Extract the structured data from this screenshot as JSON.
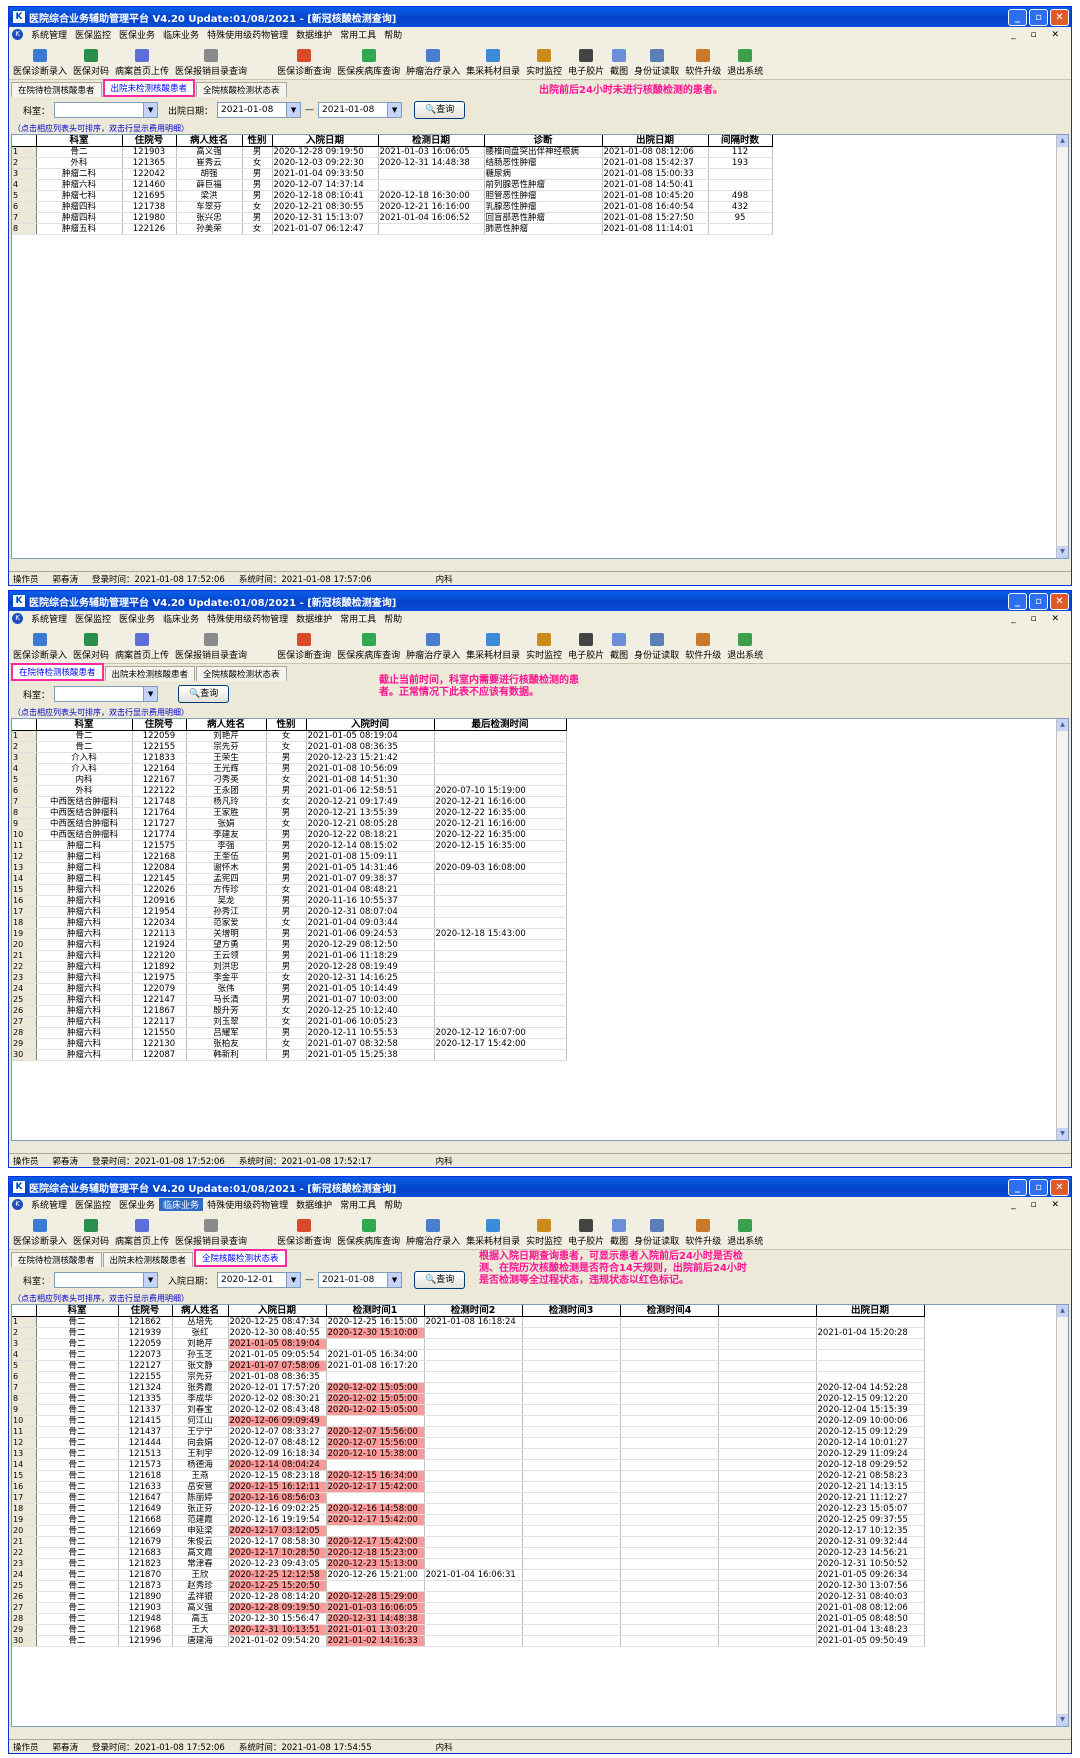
{
  "app": {
    "title": "医院综合业务辅助管理平台 V4.20 Update:01/08/2021 - [新冠核酸检测查询]",
    "menus": [
      "系统管理",
      "医保监控",
      "医保业务",
      "临床业务",
      "特殊使用级药物管理",
      "数据维护",
      "常用工具",
      "帮助"
    ],
    "toolbar_left": [
      "医保诊断录入",
      "医保对码",
      "病案首页上传",
      "医保报销目录查询"
    ],
    "toolbar_right": [
      "医保诊断查询",
      "医保疾病库查询",
      "肿瘤治疗录入",
      "集采耗材目录",
      "实时监控",
      "电子胶片",
      "截图",
      "身份证读取",
      "软件升级",
      "退出系统"
    ],
    "tabs": [
      "在院待检测核酸患者",
      "出院未检测核酸患者",
      "全院核酸检测状态表"
    ],
    "hint": "（点击相应列表头可排序，双击行显示费用明细）",
    "labels": {
      "dept": "科室：",
      "discharge_date": "出院日期：",
      "admit_date": "入院日期：",
      "query": "查询",
      "dash": "—"
    },
    "status": {
      "operator_label": "操作员",
      "operator": "郭春涛",
      "login_label": "登录时间：",
      "login_time": "2021-01-08 17:52:06",
      "sys_label": "系统时间：",
      "dept": "内科"
    }
  },
  "panel1": {
    "date_from": "2021-01-08",
    "date_to": "2021-01-08",
    "note": "出院前后24小时未进行核酸检测的患者。",
    "sys_time": "2021-01-08 17:57:06",
    "columns": [
      "",
      "科室",
      "住院号",
      "病人姓名",
      "性别",
      "入院日期",
      "检测日期",
      "诊断",
      "出院日期",
      "间隔时数"
    ],
    "rows": [
      [
        "1",
        "骨二",
        "121903",
        "高义强",
        "男",
        "2020-12-28 09:19:50",
        "2021-01-03 16:06:05",
        "腰椎间盘突出伴神经根病",
        "2021-01-08 08:12:06",
        "112"
      ],
      [
        "2",
        "外科",
        "121365",
        "崔秀云",
        "女",
        "2020-12-03 09:22:30",
        "2020-12-31 14:48:38",
        "结肠恶性肿瘤",
        "2021-01-08 15:42:37",
        "193"
      ],
      [
        "3",
        "肿瘤二科",
        "122042",
        "胡强",
        "男",
        "2021-01-04 09:33:50",
        "",
        "糖尿病",
        "2021-01-08 15:00:33",
        ""
      ],
      [
        "4",
        "肿瘤六科",
        "121460",
        "薛巨福",
        "男",
        "2020-12-07 14:37:14",
        "",
        "前列腺恶性肿瘤",
        "2021-01-08 14:50:41",
        ""
      ],
      [
        "5",
        "肿瘤七科",
        "121695",
        "梁洪",
        "男",
        "2020-12-18 08:10:41",
        "2020-12-18 16:30:00",
        "胆管恶性肿瘤",
        "2021-01-08 10:45:20",
        "498"
      ],
      [
        "6",
        "肿瘤四科",
        "121738",
        "车翠芬",
        "女",
        "2020-12-21 08:30:55",
        "2020-12-21 16:16:00",
        "乳腺恶性肿瘤",
        "2021-01-08 16:40:54",
        "432"
      ],
      [
        "7",
        "肿瘤四科",
        "121980",
        "张兴忠",
        "男",
        "2020-12-31 15:13:07",
        "2021-01-04 16:06:52",
        "回盲部恶性肿瘤",
        "2021-01-08 15:27:50",
        "95"
      ],
      [
        "8",
        "肿瘤五科",
        "122126",
        "孙美荣",
        "女",
        "2021-01-07 06:12:47",
        "",
        "肺恶性肿瘤",
        "2021-01-08 11:14:01",
        ""
      ]
    ]
  },
  "panel2": {
    "note": "截止当前时间，科室内需要进行核酸检测的患者。正常情况下此表不应该有数据。",
    "sys_time": "2021-01-08 17:52:17",
    "columns": [
      "",
      "科室",
      "住院号",
      "病人姓名",
      "性别",
      "入院时间",
      "最后检测时间"
    ],
    "rows": [
      [
        "1",
        "骨二",
        "122059",
        "刘艳芹",
        "女",
        "2021-01-05 08:19:04",
        ""
      ],
      [
        "2",
        "骨二",
        "122155",
        "宗先芬",
        "女",
        "2021-01-08 08:36:35",
        ""
      ],
      [
        "3",
        "介入科",
        "121833",
        "王荣生",
        "男",
        "2020-12-23 15:21:42",
        ""
      ],
      [
        "4",
        "介入科",
        "122164",
        "王光辉",
        "男",
        "2021-01-08 10:56:09",
        ""
      ],
      [
        "5",
        "内科",
        "122167",
        "刁秀英",
        "女",
        "2021-01-08 14:51:30",
        ""
      ],
      [
        "6",
        "外科",
        "122122",
        "王永团",
        "男",
        "2021-01-06 12:58:51",
        "2020-07-10 15:19:00"
      ],
      [
        "7",
        "中西医结合肿瘤科",
        "121748",
        "杨凡玲",
        "女",
        "2020-12-21 09:17:49",
        "2020-12-21 16:16:00"
      ],
      [
        "8",
        "中西医结合肿瘤科",
        "121764",
        "王家胜",
        "男",
        "2020-12-21 13:55:39",
        "2020-12-22 16:35:00"
      ],
      [
        "9",
        "中西医结合肿瘤科",
        "121727",
        "张娟",
        "女",
        "2020-12-21 08:05:28",
        "2020-12-21 16:16:00"
      ],
      [
        "10",
        "中西医结合肿瘤科",
        "121774",
        "李建友",
        "男",
        "2020-12-22 08:18:21",
        "2020-12-22 16:35:00"
      ],
      [
        "11",
        "肿瘤二科",
        "121575",
        "李强",
        "男",
        "2020-12-14 08:15:02",
        "2020-12-15 16:35:00"
      ],
      [
        "12",
        "肿瘤二科",
        "122168",
        "王奎伍",
        "男",
        "2021-01-08 15:09:11",
        ""
      ],
      [
        "13",
        "肿瘤二科",
        "122084",
        "谢怀木",
        "男",
        "2021-01-05 14:31:46",
        "2020-09-03 16:08:00"
      ],
      [
        "14",
        "肿瘤二科",
        "122145",
        "孟宪四",
        "男",
        "2021-01-07 09:38:37",
        ""
      ],
      [
        "15",
        "肿瘤六科",
        "122026",
        "方传珍",
        "女",
        "2021-01-04 08:48:21",
        ""
      ],
      [
        "16",
        "肿瘤六科",
        "120916",
        "吴龙",
        "男",
        "2020-11-16 10:55:37",
        ""
      ],
      [
        "17",
        "肿瘤六科",
        "121954",
        "孙秀江",
        "男",
        "2020-12-31 08:07:04",
        ""
      ],
      [
        "18",
        "肿瘤六科",
        "122034",
        "范家爱",
        "女",
        "2021-01-04 09:03:44",
        ""
      ],
      [
        "19",
        "肿瘤六科",
        "122113",
        "关增明",
        "男",
        "2021-01-06 09:24:53",
        "2020-12-18 15:43:00"
      ],
      [
        "20",
        "肿瘤六科",
        "121924",
        "望方勇",
        "男",
        "2020-12-29 08:12:50",
        ""
      ],
      [
        "21",
        "肿瘤六科",
        "122120",
        "王云领",
        "男",
        "2021-01-06 11:18:29",
        ""
      ],
      [
        "22",
        "肿瘤六科",
        "121892",
        "刘洪忠",
        "男",
        "2020-12-28 08:19:49",
        ""
      ],
      [
        "23",
        "肿瘤六科",
        "121975",
        "李金平",
        "女",
        "2020-12-31 14:16:25",
        ""
      ],
      [
        "24",
        "肿瘤六科",
        "122079",
        "张伟",
        "男",
        "2021-01-05 10:14:49",
        ""
      ],
      [
        "25",
        "肿瘤六科",
        "122147",
        "马长清",
        "男",
        "2021-01-07 10:03:00",
        ""
      ],
      [
        "26",
        "肿瘤六科",
        "121867",
        "殷升芳",
        "女",
        "2020-12-25 10:12:40",
        ""
      ],
      [
        "27",
        "肿瘤六科",
        "122117",
        "刘玉翠",
        "女",
        "2021-01-06 10:05:23",
        ""
      ],
      [
        "28",
        "肿瘤六科",
        "121550",
        "吕耀军",
        "男",
        "2020-12-11 10:55:53",
        "2020-12-12 16:07:00"
      ],
      [
        "29",
        "肿瘤六科",
        "122130",
        "张柏友",
        "女",
        "2021-01-07 08:32:58",
        "2020-12-17 15:42:00"
      ],
      [
        "30",
        "肿瘤六科",
        "122087",
        "韩新利",
        "男",
        "2021-01-05 15:25:38",
        ""
      ]
    ]
  },
  "panel3": {
    "date_from": "2020-12-01",
    "date_to": "2021-01-08",
    "note": "根据入院日期查询患者，可显示患者入院前后24小时是否检测、在院历次核酸检测是否符合14天规则，出院前后24小时是否检测等全过程状态，违规状态以红色标记。",
    "sys_time": "2021-01-08 17:54:55",
    "columns": [
      "",
      "科室",
      "住院号",
      "病人姓名",
      "入院日期",
      "检测时间1",
      "检测时间2",
      "检测时间3",
      "检测时间4",
      "",
      "出院日期"
    ],
    "rows": [
      [
        "1",
        "骨二",
        "121862",
        "丛培先",
        "2020-12-25 08:47:34",
        "2020-12-25 16:15:00",
        "2021-01-08 16:18:24",
        "",
        "",
        "",
        ""
      ],
      [
        "2",
        "骨二",
        "121939",
        "张红",
        "2020-12-30 08:40:55",
        "2020-12-30 15:10:00",
        "",
        "",
        "",
        "",
        "2021-01-04 15:20:28"
      ],
      [
        "3",
        "骨二",
        "122059",
        "刘艳芹",
        "2021-01-05 08:19:04",
        "",
        "",
        "",
        "",
        "",
        ""
      ],
      [
        "4",
        "骨二",
        "122073",
        "孙玉芝",
        "2021-01-05 09:05:54",
        "2021-01-05 16:34:00",
        "",
        "",
        "",
        "",
        ""
      ],
      [
        "5",
        "骨二",
        "122127",
        "张文静",
        "2021-01-07 07:58:06",
        "2021-01-08 16:17:20",
        "",
        "",
        "",
        "",
        ""
      ],
      [
        "6",
        "骨二",
        "122155",
        "宗先芬",
        "2021-01-08 08:36:35",
        "",
        "",
        "",
        "",
        "",
        ""
      ],
      [
        "7",
        "骨二",
        "121324",
        "张秀霞",
        "2020-12-01 17:57:20",
        "2020-12-02 15:05:00",
        "",
        "",
        "",
        "",
        "2020-12-04 14:52:28"
      ],
      [
        "8",
        "骨二",
        "121335",
        "李成华",
        "2020-12-02 08:30:21",
        "2020-12-02 15:05:00",
        "",
        "",
        "",
        "",
        "2020-12-15 09:12:20"
      ],
      [
        "9",
        "骨二",
        "121337",
        "刘春宝",
        "2020-12-02 08:43:48",
        "2020-12-02 15:05:00",
        "",
        "",
        "",
        "",
        "2020-12-04 15:15:39"
      ],
      [
        "10",
        "骨二",
        "121415",
        "何江山",
        "2020-12-06 09:09:49",
        "",
        "",
        "",
        "",
        "",
        "2020-12-09 10:00:06"
      ],
      [
        "11",
        "骨二",
        "121437",
        "王宁宁",
        "2020-12-07 08:33:27",
        "2020-12-07 15:56:00",
        "",
        "",
        "",
        "",
        "2020-12-15 09:12:29"
      ],
      [
        "12",
        "骨二",
        "121444",
        "向会娟",
        "2020-12-07 08:48:12",
        "2020-12-07 15:56:00",
        "",
        "",
        "",
        "",
        "2020-12-14 10:01:27"
      ],
      [
        "13",
        "骨二",
        "121513",
        "王利宇",
        "2020-12-09 16:18:34",
        "2020-12-10 15:38:00",
        "",
        "",
        "",
        "",
        "2020-12-29 11:09:24"
      ],
      [
        "14",
        "骨二",
        "121573",
        "杨德海",
        "2020-12-14 08:04:24",
        "",
        "",
        "",
        "",
        "",
        "2020-12-18 09:29:52"
      ],
      [
        "15",
        "骨二",
        "121618",
        "王燕",
        "2020-12-15 08:23:18",
        "2020-12-15 16:34:00",
        "",
        "",
        "",
        "",
        "2020-12-21 08:58:23"
      ],
      [
        "16",
        "骨二",
        "121633",
        "岳安营",
        "2020-12-15 16:12:11",
        "2020-12-17 15:42:00",
        "",
        "",
        "",
        "",
        "2020-12-21 14:13:15"
      ],
      [
        "17",
        "骨二",
        "121647",
        "陈丽婷",
        "2020-12-16 08:56:03",
        "",
        "",
        "",
        "",
        "",
        "2020-12-21 11:12:27"
      ],
      [
        "18",
        "骨二",
        "121649",
        "张正芬",
        "2020-12-16 09:02:25",
        "2020-12-16 14:58:00",
        "",
        "",
        "",
        "",
        "2020-12-23 15:05:07"
      ],
      [
        "19",
        "骨二",
        "121668",
        "范建霞",
        "2020-12-16 19:19:54",
        "2020-12-17 15:42:00",
        "",
        "",
        "",
        "",
        "2020-12-25 09:37:55"
      ],
      [
        "20",
        "骨二",
        "121669",
        "申延梁",
        "2020-12-17 03:12:05",
        "",
        "",
        "",
        "",
        "",
        "2020-12-17 10:12:35"
      ],
      [
        "21",
        "骨二",
        "121679",
        "朱俊云",
        "2020-12-17 08:58:30",
        "2020-12-17 15:42:00",
        "",
        "",
        "",
        "",
        "2020-12-31 09:32:44"
      ],
      [
        "22",
        "骨二",
        "121683",
        "高文霞",
        "2020-12-17 10:28:50",
        "2020-12-18 15:23:00",
        "",
        "",
        "",
        "",
        "2020-12-23 14:56:21"
      ],
      [
        "23",
        "骨二",
        "121823",
        "常津春",
        "2020-12-23 09:43:05",
        "2020-12-23 15:13:00",
        "",
        "",
        "",
        "",
        "2020-12-31 10:50:52"
      ],
      [
        "24",
        "骨二",
        "121870",
        "王欣",
        "2020-12-25 12:12:58",
        "2020-12-26 15:21:00",
        "2021-01-04 16:06:31",
        "",
        "",
        "",
        "2021-01-05 09:26:34"
      ],
      [
        "25",
        "骨二",
        "121873",
        "赵秀珍",
        "2020-12-25 15:20:50",
        "",
        "",
        "",
        "",
        "",
        "2020-12-30 13:07:56"
      ],
      [
        "26",
        "骨二",
        "121890",
        "孟祥银",
        "2020-12-28 08:14:20",
        "2020-12-28 15:29:00",
        "",
        "",
        "",
        "",
        "2020-12-31 08:40:03"
      ],
      [
        "27",
        "骨二",
        "121903",
        "高义强",
        "2020-12-28 09:19:50",
        "2021-01-03 16:06:05",
        "",
        "",
        "",
        "",
        "2021-01-08 08:12:06"
      ],
      [
        "28",
        "骨二",
        "121948",
        "高玉",
        "2020-12-30 15:56:47",
        "2020-12-31 14:48:38",
        "",
        "",
        "",
        "",
        "2021-01-05 08:48:50"
      ],
      [
        "29",
        "骨二",
        "121968",
        "王大",
        "2020-12-31 10:13:51",
        "2021-01-01 13:03:20",
        "",
        "",
        "",
        "",
        "2021-01-04 13:48:23"
      ],
      [
        "30",
        "骨二",
        "121996",
        "唐建海",
        "2021-01-02 09:54:20",
        "2021-01-02 14:16:33",
        "",
        "",
        "",
        "",
        "2021-01-05 09:50:49"
      ]
    ],
    "red_cells": [
      [
        2,
        5
      ],
      [
        3,
        4
      ],
      [
        5,
        4
      ],
      [
        7,
        5
      ],
      [
        8,
        5
      ],
      [
        9,
        5
      ],
      [
        10,
        4
      ],
      [
        11,
        5
      ],
      [
        12,
        5
      ],
      [
        13,
        5
      ],
      [
        14,
        4
      ],
      [
        15,
        5
      ],
      [
        16,
        4
      ],
      [
        16,
        5
      ],
      [
        17,
        4
      ],
      [
        18,
        5
      ],
      [
        19,
        5
      ],
      [
        20,
        4
      ],
      [
        21,
        5
      ],
      [
        22,
        4
      ],
      [
        22,
        5
      ],
      [
        23,
        5
      ],
      [
        24,
        4
      ],
      [
        25,
        4
      ],
      [
        26,
        5
      ],
      [
        27,
        4
      ],
      [
        27,
        5
      ],
      [
        28,
        5
      ],
      [
        29,
        4
      ],
      [
        29,
        5
      ],
      [
        30,
        5
      ]
    ]
  },
  "colors": {
    "accent": "#0543c8",
    "highlight": "#ff2aa0",
    "note": "#ff1493",
    "red_cell": "#ff9a9a"
  }
}
